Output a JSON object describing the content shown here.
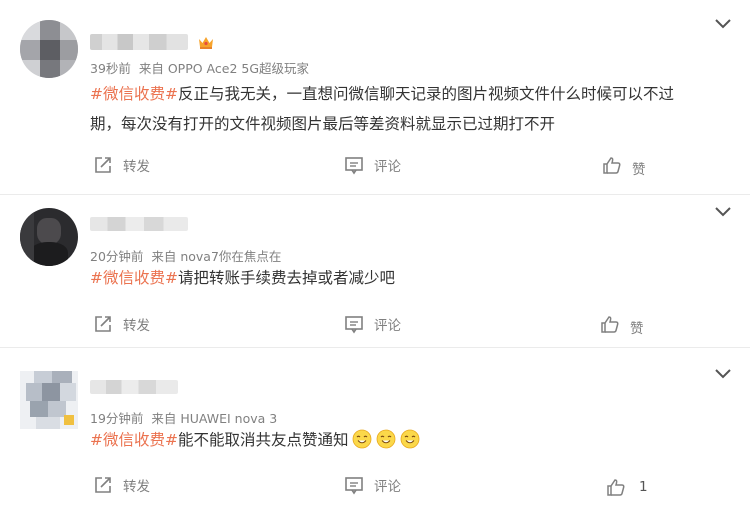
{
  "posts": [
    {
      "time": "39秒前",
      "source": "来自 OPPO Ace2 5G超级玩家",
      "tag": "#微信收费#",
      "text_line1": "反正与我无关，一直想问微信聊天记录的图片视频文件什么时候可以不过",
      "text_line2": "期，每次没有打开的文件视频图片最后等差资料就显示已过期打不开",
      "forward_label": "转发",
      "comment_label": "评论",
      "like_label": "赞"
    },
    {
      "time": "20分钟前",
      "source": "来自 nova7你在焦点在",
      "tag": "#微信收费#",
      "text": "请把转账手续费去掉或者减少吧",
      "forward_label": "转发",
      "comment_label": "评论",
      "like_label": "赞"
    },
    {
      "time": "19分钟前",
      "source": "来自 HUAWEI nova 3",
      "tag": "#微信收费#",
      "text": "能不能取消共友点赞通知",
      "forward_label": "转发",
      "comment_label": "评论",
      "like_count": "1"
    }
  ],
  "colors": {
    "tag": "#eb7350",
    "text": "#333333",
    "meta": "#808080",
    "divider": "#ebebeb"
  },
  "icons": [
    "chevron-down-icon",
    "crown-badge-icon",
    "forward-icon",
    "comment-icon",
    "like-icon",
    "smile-emoji-icon"
  ]
}
